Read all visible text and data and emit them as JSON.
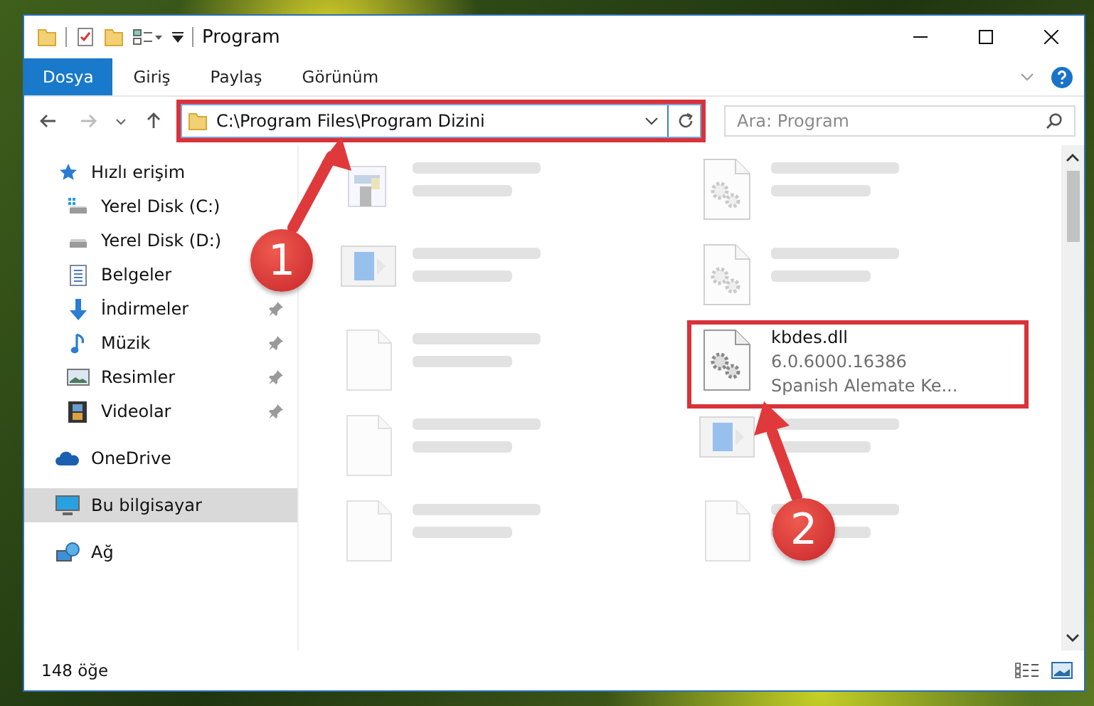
{
  "window": {
    "title": "Program"
  },
  "ribbon_tabs": [
    {
      "label": "Dosya",
      "selected": true
    },
    {
      "label": "Giriş",
      "selected": false
    },
    {
      "label": "Paylaş",
      "selected": false
    },
    {
      "label": "Görünüm",
      "selected": false
    }
  ],
  "nav_buttons": [
    {
      "kind": "back",
      "disabled": false
    },
    {
      "kind": "forward",
      "disabled": true
    },
    {
      "kind": "recent",
      "disabled": false
    },
    {
      "kind": "up",
      "disabled": false
    }
  ],
  "address_bar": {
    "value": "C:\\Program Files\\Program Dizini",
    "highlighted": true
  },
  "search": {
    "placeholder": "Ara: Program"
  },
  "sidebar": {
    "items": [
      {
        "label": "Hızlı erişim",
        "kind": "star",
        "selected": false,
        "pinned": false,
        "children": [
          {
            "label": "Yerel Disk (C:)",
            "kind": "system-drive",
            "selected": false,
            "pinned": false
          },
          {
            "label": "Yerel Disk (D:)",
            "kind": "drive",
            "selected": false,
            "pinned": false
          },
          {
            "label": "Belgeler",
            "kind": "document",
            "selected": false,
            "pinned": false
          },
          {
            "label": "İndirmeler",
            "kind": "download",
            "selected": false,
            "pinned": true
          },
          {
            "label": "Müzik",
            "kind": "music",
            "selected": false,
            "pinned": true
          },
          {
            "label": "Resimler",
            "kind": "picture",
            "selected": false,
            "pinned": true
          },
          {
            "label": "Videolar",
            "kind": "video",
            "selected": false,
            "pinned": true
          }
        ]
      },
      {
        "label": "OneDrive",
        "kind": "cloud",
        "selected": false,
        "pinned": false
      },
      {
        "label": "Bu bilgisayar",
        "kind": "computer",
        "selected": true,
        "pinned": false
      },
      {
        "label": "Ağ",
        "kind": "network",
        "selected": false,
        "pinned": false
      }
    ]
  },
  "files": [
    {
      "kind": "app",
      "blurred": true,
      "highlighted": false
    },
    {
      "kind": "dll",
      "blurred": true,
      "highlighted": false
    },
    {
      "kind": "installer",
      "blurred": true,
      "highlighted": false
    },
    {
      "kind": "dll",
      "blurred": true,
      "highlighted": false
    },
    {
      "kind": "blank",
      "blurred": true,
      "highlighted": false
    },
    {
      "name": "kbdes.dll",
      "details": [
        "6.0.6000.16386",
        "Spanish Alemate Ke..."
      ],
      "kind": "dll",
      "blurred": false,
      "highlighted": true
    },
    {
      "kind": "blank",
      "blurred": true,
      "highlighted": false
    },
    {
      "kind": "installer",
      "blurred": true,
      "highlighted": false
    },
    {
      "kind": "blank",
      "blurred": true,
      "highlighted": false
    },
    {
      "kind": "blank",
      "blurred": true,
      "highlighted": false
    }
  ],
  "annotations": [
    {
      "number": "1"
    },
    {
      "number": "2"
    }
  ],
  "status_bar": {
    "item_count": "148 öğe"
  }
}
